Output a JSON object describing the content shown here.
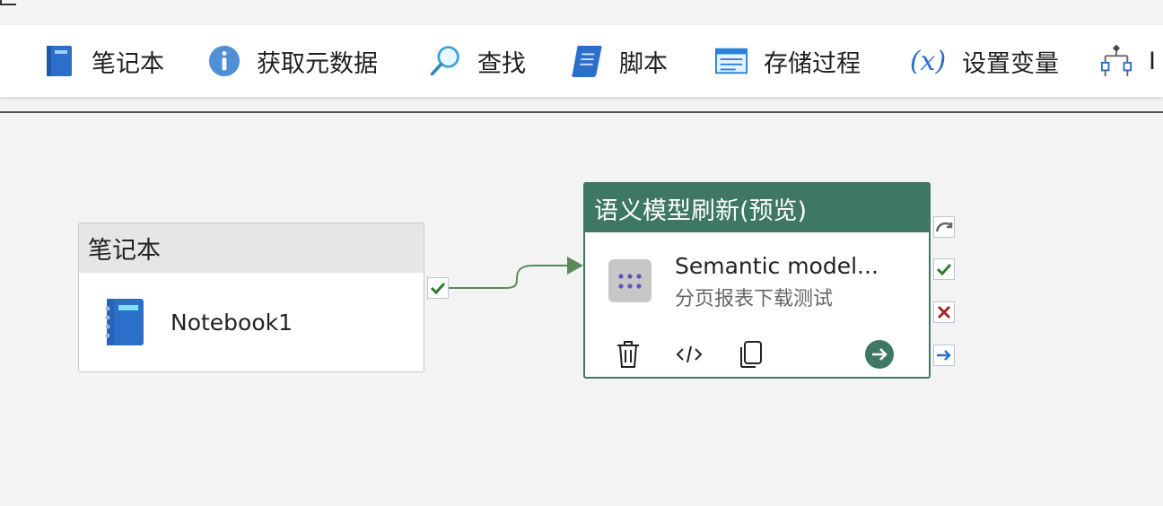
{
  "toolbar": {
    "items": [
      {
        "label": "笔记本",
        "icon": "notebook-icon"
      },
      {
        "label": "获取元数据",
        "icon": "info-icon"
      },
      {
        "label": "查找",
        "icon": "lookup-icon"
      },
      {
        "label": "脚本",
        "icon": "script-icon"
      },
      {
        "label": "存储过程",
        "icon": "stored-procedure-icon"
      },
      {
        "label": "设置变量",
        "icon": "set-variable-icon"
      },
      {
        "label": "I",
        "icon": "if-condition-icon"
      }
    ],
    "variable_glyph": "(x)"
  },
  "nodes": {
    "notebook": {
      "header": "笔记本",
      "name": "Notebook1",
      "icon": "notebook-icon"
    },
    "semantic": {
      "header": "语义模型刷新(预览)",
      "title": "Semantic model...",
      "subtitle": "分页报表下载测试",
      "icon": "semantic-model-icon",
      "actions": [
        "delete-icon",
        "code-icon",
        "copy-icon",
        "go-arrow-icon"
      ]
    }
  },
  "ports": [
    "skip-icon",
    "success-check-icon",
    "fail-x-icon",
    "completion-arrow-icon"
  ],
  "colors": {
    "node_header_green": "#3e7762",
    "connector_green": "#5a8a5a",
    "success_check": "#2e7d32",
    "fail_x": "#a4262c",
    "completion_arrow": "#2b6fc9",
    "notebook_blue": "#2b6fc9"
  }
}
